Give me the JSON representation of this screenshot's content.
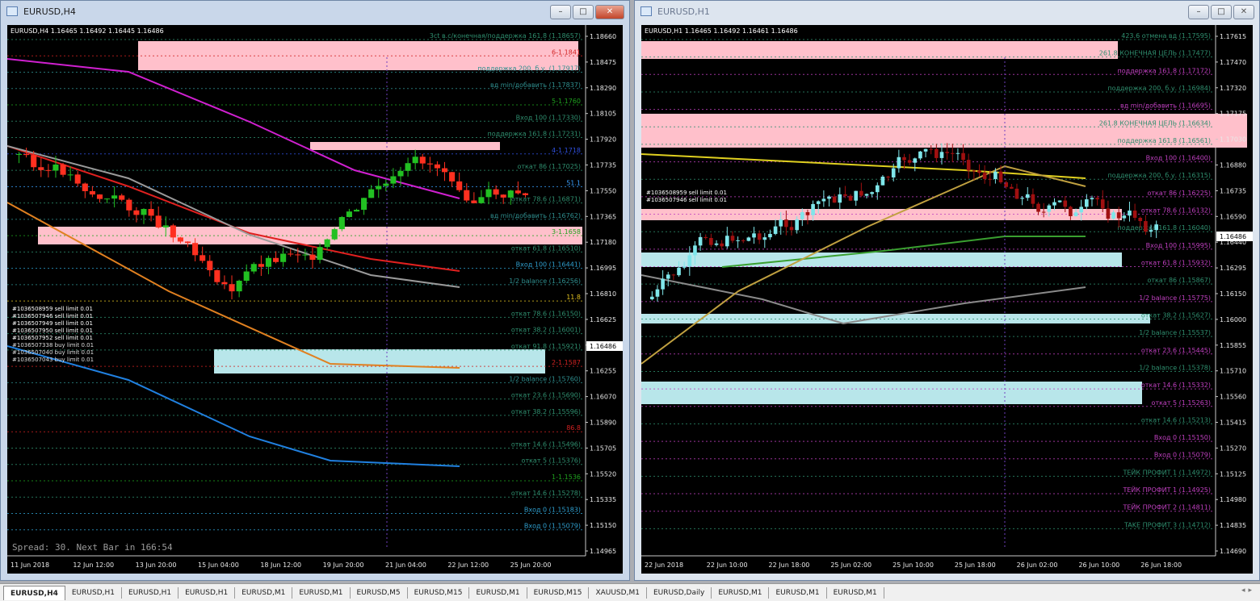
{
  "windows": [
    {
      "title": "EURUSD,H4",
      "symbol_line": "EURUSD,H4  1.16465 1.16492 1.16445 1.16486",
      "spread": "Spread: 30. Next Bar in 166:54",
      "current_price": "1.16486",
      "price_labels": [
        "1.18660",
        "1.18475",
        "1.18290",
        "1.18105",
        "1.17920",
        "1.17735",
        "1.17550",
        "1.17365",
        "1.17180",
        "1.16995",
        "1.16810",
        "1.16625",
        "1.16440",
        "1.16255",
        "1.16070",
        "1.15890",
        "1.15705",
        "1.15520",
        "1.15335",
        "1.15150",
        "1.14965"
      ],
      "time_labels": [
        "11 Jun 2018",
        "12 Jun 12:00",
        "13 Jun 20:00",
        "15 Jun 04:00",
        "18 Jun 12:00",
        "19 Jun 20:00",
        "21 Jun 04:00",
        "22 Jun 12:00",
        "25 Jun 20:00"
      ],
      "levels": [
        {
          "text": "3ct в.с/конечная/поддержка 161.8 (1.18657)",
          "color": "#2f8f6f"
        },
        {
          "text": "6-1.1841",
          "color": "#d12222"
        },
        {
          "text": "поддержка 200, б.у. (1.17917)",
          "color": "#2f8f8f"
        },
        {
          "text": "вд min/добавить (1.17837)",
          "color": "#2f8f8f"
        },
        {
          "text": "5-1.1760",
          "color": "#1fa31f"
        },
        {
          "text": "Вход 100 (1.17330)",
          "color": "#2f8f6f"
        },
        {
          "text": "поддержка 161.8 (1.17231)",
          "color": "#2f8f6f"
        },
        {
          "text": "4-1.1718",
          "color": "#3050e0"
        },
        {
          "text": "откат 86 (1.17025)",
          "color": "#2f8f6f"
        },
        {
          "text": "51.1",
          "color": "#3aa0ff"
        },
        {
          "text": "откат 78.6 (1.16871)",
          "color": "#2f8f6f"
        },
        {
          "text": "вд min/добавить (1.16762)",
          "color": "#2f8f8f"
        },
        {
          "text": "3-1.1658",
          "color": "#1fa31f"
        },
        {
          "text": "откат 61.8 (1.16510)",
          "color": "#2f8f6f"
        },
        {
          "text": "Вход 100 (1.16441)",
          "color": "#2fa0d0"
        },
        {
          "text": "1/2 balance (1.16256)",
          "color": "#2f8f8f"
        },
        {
          "text": "11.8",
          "color": "#e0c020"
        },
        {
          "text": "откат 78.6 (1.16150)",
          "color": "#2f8f6f"
        },
        {
          "text": "откат 38.2 (1.16001)",
          "color": "#2f8f6f"
        },
        {
          "text": "откат 91.8 (1.15921)",
          "color": "#2f8f6f"
        },
        {
          "text": "2-1.1587",
          "color": "#d12222"
        },
        {
          "text": "1/2 balance (1.15760)",
          "color": "#2f8f8f"
        },
        {
          "text": "откат 23.6 (1.15690)",
          "color": "#2f8f6f"
        },
        {
          "text": "откат 38.2 (1.15596)",
          "color": "#2f8f6f"
        },
        {
          "text": "86.8",
          "color": "#d12222"
        },
        {
          "text": "откат 14.6 (1.15496)",
          "color": "#2f8f6f"
        },
        {
          "text": "откат 5 (1.15376)",
          "color": "#2f8f6f"
        },
        {
          "text": "1-1.1536",
          "color": "#1fa31f"
        },
        {
          "text": "откат 14.6 (1.15278)",
          "color": "#2f8f6f"
        },
        {
          "text": "Вход 0 (1.15183)",
          "color": "#2fa0d0"
        },
        {
          "text": "Вход 0 (1.15079)",
          "color": "#2fa0d0"
        }
      ],
      "orders": [
        "#1036508959 sell limit 0.01",
        "#1036507946 sell limit 0.01",
        "#1036507949 sell limit 0.01",
        "#1036507950 sell limit 0.01",
        "#1036507952 sell limit 0.01",
        "#1036507338 buy limit 0.01",
        "#1036507040 buy limit 0.01",
        "#1036507043 buy limit 0.01"
      ]
    },
    {
      "title": "EURUSD,H1",
      "symbol_line": "EURUSD,H1  1.16465 1.16492 1.16461 1.16486",
      "current_price": "1.16486",
      "price_labels": [
        "1.17615",
        "1.17470",
        "1.17320",
        "1.17175",
        "1.17030",
        "1.16880",
        "1.16735",
        "1.16590",
        "1.16440",
        "1.16295",
        "1.16150",
        "1.16000",
        "1.15855",
        "1.15710",
        "1.15560",
        "1.15415",
        "1.15270",
        "1.15125",
        "1.14980",
        "1.14835",
        "1.14690"
      ],
      "time_labels": [
        "22 Jun 2018",
        "22 Jun 10:00",
        "22 Jun 18:00",
        "25 Jun 02:00",
        "25 Jun 10:00",
        "25 Jun 18:00",
        "26 Jun 02:00",
        "26 Jun 10:00",
        "26 Jun 18:00"
      ],
      "levels": [
        {
          "text": "423.6 отмена вд (1.17595)",
          "color": "#2f8f6f"
        },
        {
          "text": "261.8 КОНЕЧНАЯ ЦЕЛЬ (1.17477)",
          "color": "#2f8f6f"
        },
        {
          "text": "поддержка 161.8 (1.17172)",
          "color": "#c040c0"
        },
        {
          "text": "поддержка 200, б.у. (1.16984)",
          "color": "#2f8f6f"
        },
        {
          "text": "вд min/добавить (1.16695)",
          "color": "#c040c0"
        },
        {
          "text": "261.8 КОНЕЧНАЯ ЦЕЛЬ (1.16634)",
          "color": "#2f8f6f"
        },
        {
          "text": "поддержка 161.8 (1.16561)",
          "color": "#2f8f6f"
        },
        {
          "text": "Вход 100 (1.16400)",
          "color": "#c040c0"
        },
        {
          "text": "поддержка 200, б.у. (1.16315)",
          "color": "#2f8f6f"
        },
        {
          "text": "откат 86 (1.16225)",
          "color": "#c040c0"
        },
        {
          "text": "откат 78.6 (1.16132)",
          "color": "#c040c0"
        },
        {
          "text": "поддержка 161.8 (1.16040)",
          "color": "#2f8f6f"
        },
        {
          "text": "Вход 100 (1.15995)",
          "color": "#c040c0"
        },
        {
          "text": "откат 61.8 (1.15932)",
          "color": "#c040c0"
        },
        {
          "text": "откат 86 (1.15867)",
          "color": "#2f8f6f"
        },
        {
          "text": "1/2 balance (1.15775)",
          "color": "#c040c0"
        },
        {
          "text": "откат 38.2 (1.15627)",
          "color": "#2f8f6f"
        },
        {
          "text": "1/2 balance (1.15537)",
          "color": "#2f8f6f"
        },
        {
          "text": "откат 23.6 (1.15445)",
          "color": "#c040c0"
        },
        {
          "text": "1/2 balance (1.15378)",
          "color": "#2f8f6f"
        },
        {
          "text": "откат 14.6 (1.15332)",
          "color": "#c040c0"
        },
        {
          "text": "откат 5 (1.15263)",
          "color": "#c040c0"
        },
        {
          "text": "откат 14.6 (1.15213)",
          "color": "#2f8f6f"
        },
        {
          "text": "Вход 0 (1.15150)",
          "color": "#c040c0"
        },
        {
          "text": "Вход 0 (1.15079)",
          "color": "#c040c0"
        },
        {
          "text": "ТЕЙК ПРОФИТ 1 (1.14972)",
          "color": "#2f8f6f"
        },
        {
          "text": "ТЕЙК ПРОФИТ 1 (1.14925)",
          "color": "#c040c0"
        },
        {
          "text": "ТЕЙК ПРОФИТ 2 (1.14811)",
          "color": "#c040c0"
        },
        {
          "text": "TAKE ПРОФИТ 3 (1.14712)",
          "color": "#2f8f6f"
        }
      ],
      "orders": [
        "#1036508959 sell limit 0.01",
        "#1036507946 sell limit 0.01"
      ]
    }
  ],
  "tabs": [
    "EURUSD,H4",
    "EURUSD,H1",
    "EURUSD,H1",
    "EURUSD,H1",
    "EURUSD,M1",
    "EURUSD,M1",
    "EURUSD,M5",
    "EURUSD,M15",
    "EURUSD,M1",
    "EURUSD,M15",
    "XAUUSD,M1",
    "EURUSD,Daily",
    "EURUSD,M1",
    "EURUSD,M1",
    "EURUSD,M1"
  ],
  "active_tab": 0,
  "window_buttons": {
    "minimize": "–",
    "maximize": "□",
    "close": "✕"
  }
}
